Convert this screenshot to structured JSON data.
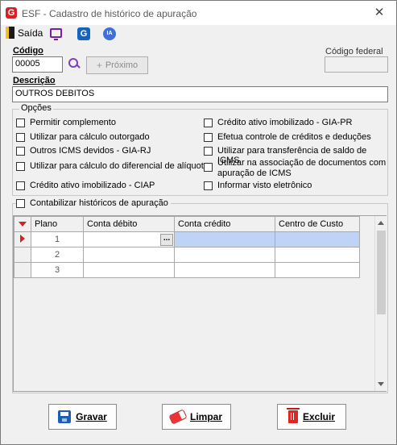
{
  "window": {
    "title": "ESF - Cadastro de histórico de apuração",
    "app_icon_letter": "G"
  },
  "toolbar": {
    "exit_label": "Saída",
    "icons": [
      "monitor-icon",
      "g-app-icon",
      "ia-icon"
    ],
    "ia_text": "IA"
  },
  "form": {
    "codigo_label": "Código",
    "codigo_value": "00005",
    "next_button_label": "Próximo",
    "codigo_federal_label": "Código federal",
    "codigo_federal_value": "",
    "descricao_label": "Descrição",
    "descricao_value": "OUTROS DEBITOS"
  },
  "options": {
    "title": "Opções",
    "left": [
      {
        "label": "Permitir complemento",
        "checked": false
      },
      {
        "label": "Utilizar para cálculo outorgado",
        "checked": false
      },
      {
        "label": "Outros ICMS devidos - GIA-RJ",
        "checked": false
      },
      {
        "label": "Utilizar para cálculo do diferencial de alíquota",
        "checked": false
      },
      {
        "label": "Crédito ativo imobilizado - CIAP",
        "checked": false
      }
    ],
    "right": [
      {
        "label": "Crédito ativo imobilizado - GIA-PR",
        "checked": false
      },
      {
        "label": "Efetua controle de créditos e deduções",
        "checked": false
      },
      {
        "label": "Utilizar para transferência de saldo de ICMS",
        "checked": false
      },
      {
        "label": "Utilizar na associação de documentos com apuração de ICMS",
        "checked": false
      },
      {
        "label": "Informar visto eletrônico",
        "checked": false
      }
    ]
  },
  "accounting": {
    "checkbox_label": "Contabilizar históricos de apuração",
    "checked": false,
    "grid": {
      "columns": [
        "Plano",
        "Conta débito",
        "Conta crédito",
        "Centro de Custo"
      ],
      "rows": [
        {
          "plano": "1",
          "debito": "",
          "credito": "",
          "centro": ""
        },
        {
          "plano": "2",
          "debito": "",
          "credito": "",
          "centro": ""
        },
        {
          "plano": "3",
          "debito": "",
          "credito": "",
          "centro": ""
        }
      ],
      "ellipsis": "..."
    }
  },
  "buttons": {
    "save": "Gravar",
    "clear": "Limpar",
    "delete": "Excluir"
  },
  "colors": {
    "brand_red": "#d52027",
    "selection": "#bed3f5"
  }
}
